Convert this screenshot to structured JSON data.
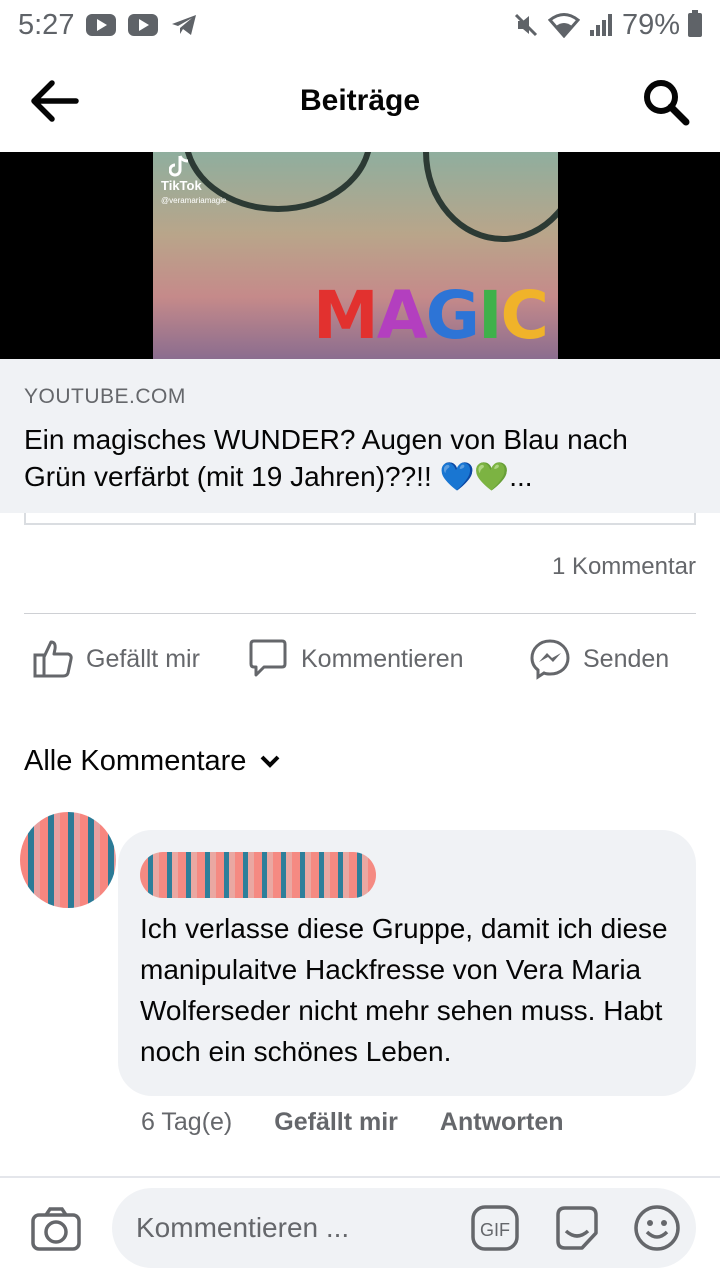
{
  "status_bar": {
    "time": "5:27",
    "battery": "79%"
  },
  "header": {
    "title": "Beiträge"
  },
  "video": {
    "watermark": "TikTok",
    "handle": "@veramariamagie",
    "overlay_text": "MAGIC"
  },
  "link_preview": {
    "domain": "YOUTUBE.COM",
    "title": "Ein magisches WUNDER? Augen von Blau nach Grün verfärbt (mit 19 Jahren)??!! 💙💚..."
  },
  "post": {
    "comment_count": "1 Kommentar",
    "actions": {
      "like": "Gefällt mir",
      "comment": "Kommentieren",
      "send": "Senden"
    }
  },
  "comments_section": {
    "filter_label": "Alle Kommentare",
    "comments": [
      {
        "text": "Ich verlasse diese Gruppe, damit ich diese manipulaitve Hackfresse von Vera Maria Wolferseder nicht mehr sehen muss. Habt noch ein schönes Leben.",
        "time": "6 Tag(e)",
        "like_label": "Gefällt mir",
        "reply_label": "Antworten"
      }
    ]
  },
  "composer": {
    "placeholder": "Kommentieren ...",
    "gif_label": "GIF"
  },
  "colors": {
    "text_primary": "#050505",
    "text_secondary": "#65676b",
    "bubble_bg": "#f0f2f5",
    "divider": "#ced0d4"
  }
}
